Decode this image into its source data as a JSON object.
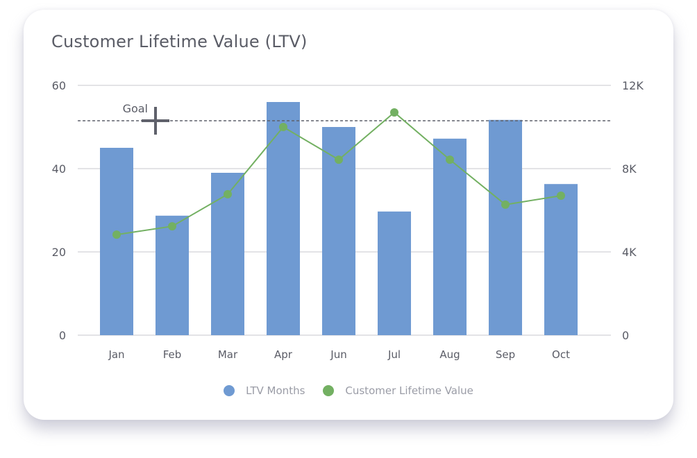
{
  "card": {
    "title": "Customer Lifetime Value (LTV)"
  },
  "chart_data": {
    "type": "bar+line",
    "title": "Customer Lifetime Value (LTV)",
    "categories": [
      "Jan",
      "Feb",
      "Mar",
      "Apr",
      "Jun",
      "Jul",
      "Aug",
      "Sep",
      "Oct"
    ],
    "series": [
      {
        "name": "LTV Months",
        "type": "bar",
        "axis": "left",
        "color": "#6f9ad2",
        "values": [
          45,
          28.7,
          39,
          56,
          50,
          29.7,
          47.2,
          51.7,
          36.3
        ]
      },
      {
        "name": "Customer Lifetime Value",
        "type": "line",
        "axis": "right",
        "color": "#73b062",
        "values": [
          4830,
          5230,
          6770,
          10000,
          8430,
          10700,
          8430,
          6270,
          6700
        ]
      }
    ],
    "left_axis": {
      "ylim": [
        0,
        60
      ],
      "ticks": [
        0,
        20,
        40,
        60
      ],
      "tick_labels": [
        "0",
        "20",
        "40",
        "60"
      ]
    },
    "right_axis": {
      "ylim": [
        0,
        12000
      ],
      "ticks": [
        0,
        4000,
        8000,
        12000
      ],
      "tick_labels": [
        "0",
        "4K",
        "8K",
        "12K"
      ]
    },
    "goal": {
      "label": "Goal",
      "value": 51.5,
      "axis": "left"
    },
    "grid": true,
    "legend_position": "bottom-center"
  },
  "legend": [
    {
      "label": "LTV Months",
      "color": "#6f9ad2"
    },
    {
      "label": "Customer Lifetime Value",
      "color": "#73b062"
    }
  ]
}
